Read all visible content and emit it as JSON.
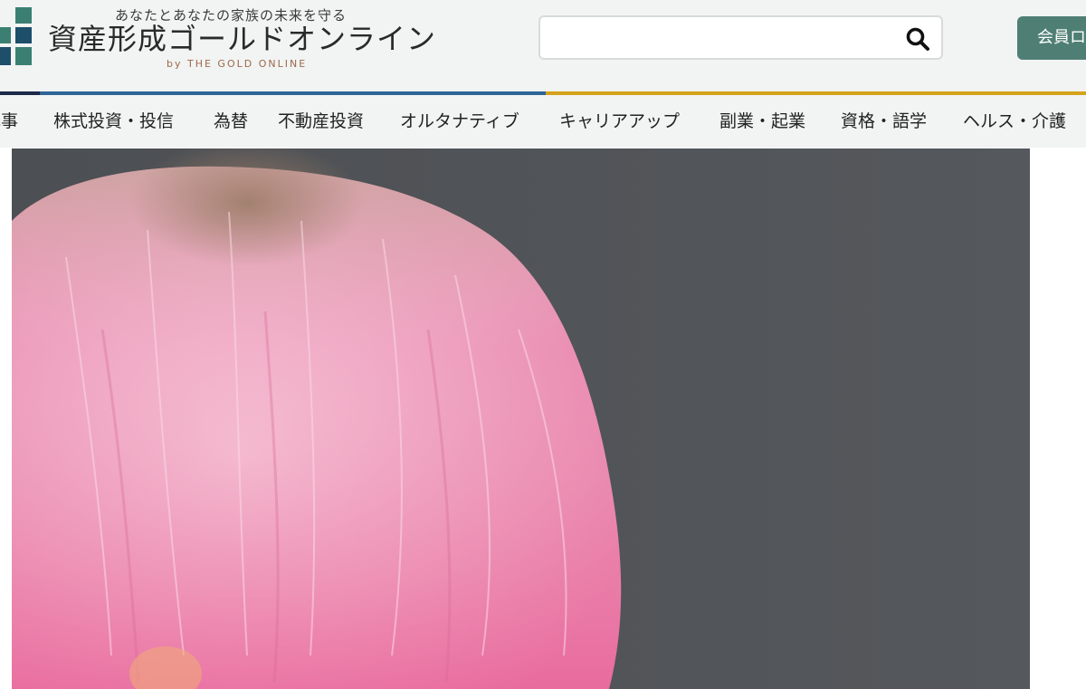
{
  "header": {
    "tagline": "あなたとあなたの家族の未来を守る",
    "site_title": "資産形成ゴールドオンライン",
    "site_subtitle": "by THE GOLD ONLINE",
    "search": {
      "placeholder": "",
      "value": ""
    },
    "member_button_label": "会員ロ"
  },
  "nav": {
    "items": [
      {
        "label": "記事"
      },
      {
        "label": "株式投資・投信"
      },
      {
        "label": "為替"
      },
      {
        "label": "不動産投資"
      },
      {
        "label": "オルタナティブ"
      },
      {
        "label": "キャリアアップ"
      },
      {
        "label": "副業・起業"
      },
      {
        "label": "資格・語学"
      },
      {
        "label": "ヘルス・介護"
      }
    ]
  },
  "colors": {
    "header_bg": "#f1f4f3",
    "brand_green": "#4f7f74",
    "logo_teal": "#3b7f72",
    "logo_navy": "#1d4e6a",
    "nav_accent_navy": "#1d2a4a",
    "nav_accent_blue": "#2d6596",
    "nav_accent_gold": "#d5a21b",
    "subtitle_brown": "#a0674b"
  },
  "hero": {
    "subject": "pink-dyed-hair-photo"
  }
}
